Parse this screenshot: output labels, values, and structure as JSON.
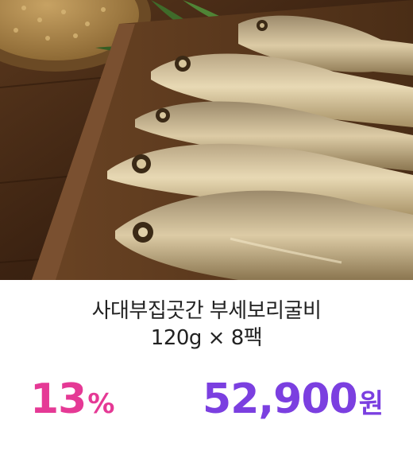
{
  "product": {
    "image_alt": "dried yellow croaker fish on wooden tray",
    "title_line1": "사대부집곳간 부세보리굴비",
    "title_line2": "120g × 8팩"
  },
  "pricing": {
    "discount_value": "13",
    "discount_unit": "%",
    "price_value": "52,900",
    "price_unit": "원"
  },
  "colors": {
    "discount": "#e53995",
    "price": "#7b3fe0",
    "title": "#222222"
  }
}
